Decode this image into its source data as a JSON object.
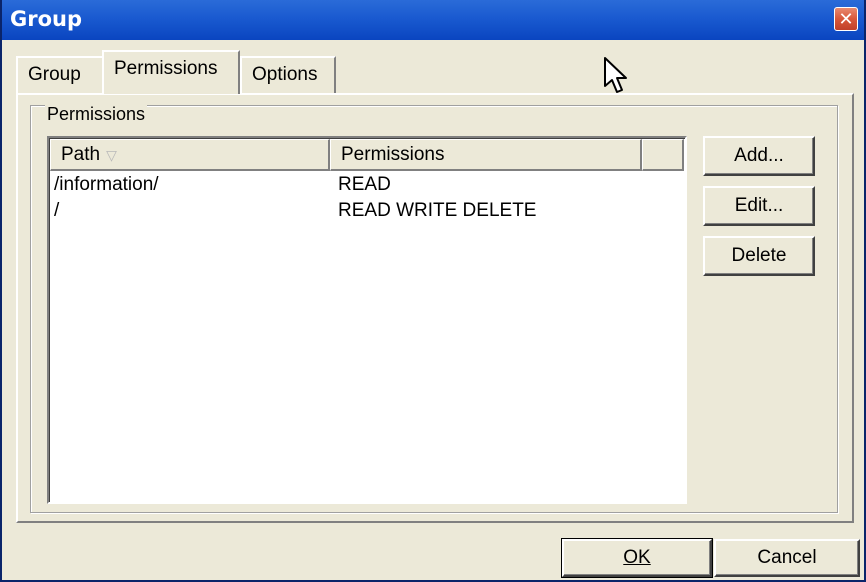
{
  "window": {
    "title": "Group",
    "close_icon": "close-icon"
  },
  "tabs": [
    {
      "label": "Group",
      "active": false
    },
    {
      "label": "Permissions",
      "active": true
    },
    {
      "label": "Options",
      "active": false
    }
  ],
  "permissions_group": {
    "label": "Permissions",
    "columns": [
      "Path",
      "Permissions"
    ],
    "rows": [
      {
        "path": "/information/",
        "permissions": "READ"
      },
      {
        "path": "/",
        "permissions": "READ WRITE DELETE"
      }
    ]
  },
  "side_buttons": {
    "add": "Add...",
    "edit": "Edit...",
    "delete": "Delete"
  },
  "footer": {
    "ok": "OK",
    "cancel": "Cancel"
  }
}
